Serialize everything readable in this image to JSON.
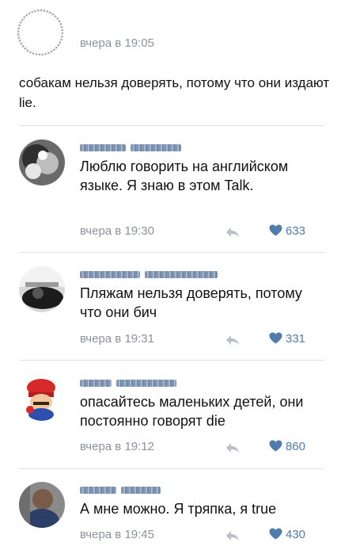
{
  "post": {
    "time": "вчера в 19:05",
    "text": "собакам нельзя доверять, потому что они издают lie."
  },
  "comments": [
    {
      "text": "Люблю говорить на английском языке. Я знаю в этом Talk.",
      "time": "вчера в 19:30",
      "likes": "633"
    },
    {
      "text": "Пляжам нельзя доверять, потому что они бич",
      "time": "вчера в 19:31",
      "likes": "331"
    },
    {
      "text": "опасайтесь маленьких детей, они постоянно говорят die",
      "time": "вчера в 19:12",
      "likes": "860"
    },
    {
      "text": "А мне можно. Я тряпка, я true",
      "time": "вчера в 19:45",
      "likes": "430"
    }
  ],
  "colors": {
    "like_accent": "#4f7bad",
    "meta_gray": "#8c929a",
    "author_blurred": "#6b84a7"
  },
  "icons": {
    "reply": "reply-arrow-icon",
    "like": "heart-icon"
  }
}
